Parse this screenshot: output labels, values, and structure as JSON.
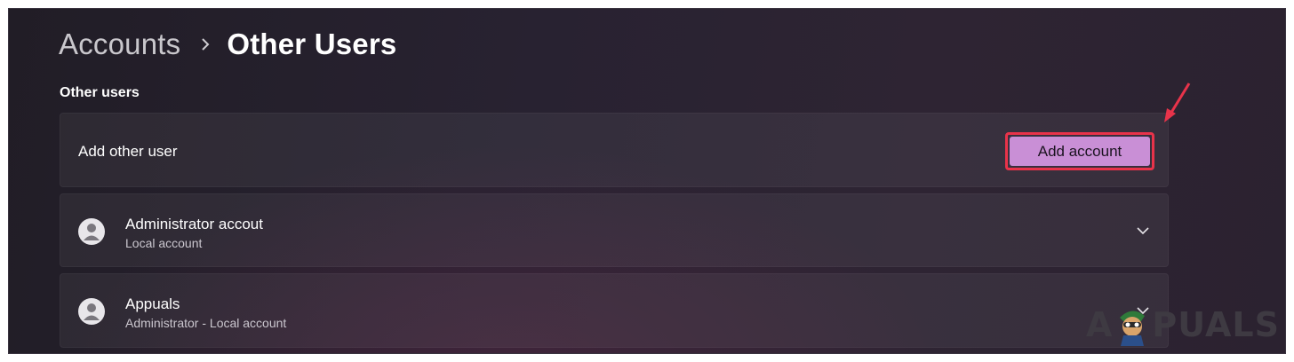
{
  "breadcrumb": {
    "parent": "Accounts",
    "separator_icon": "chevron-right-icon",
    "current": "Other Users"
  },
  "section": {
    "title": "Other users"
  },
  "add_user": {
    "label": "Add other user",
    "button_label": "Add account",
    "highlight_color": "#e8334a",
    "button_color": "#c98fd6"
  },
  "users": [
    {
      "name": "Administrator accout",
      "type": "Local account",
      "icon": "user-avatar-icon",
      "expand_icon": "chevron-down-icon"
    },
    {
      "name": "Appuals",
      "type": "Administrator - Local account",
      "icon": "user-avatar-icon",
      "expand_icon": "chevron-down-icon"
    }
  ],
  "annotation": {
    "arrow_color": "#e8334a"
  },
  "watermark": {
    "text_left": "A",
    "text_right": "PUALS"
  }
}
